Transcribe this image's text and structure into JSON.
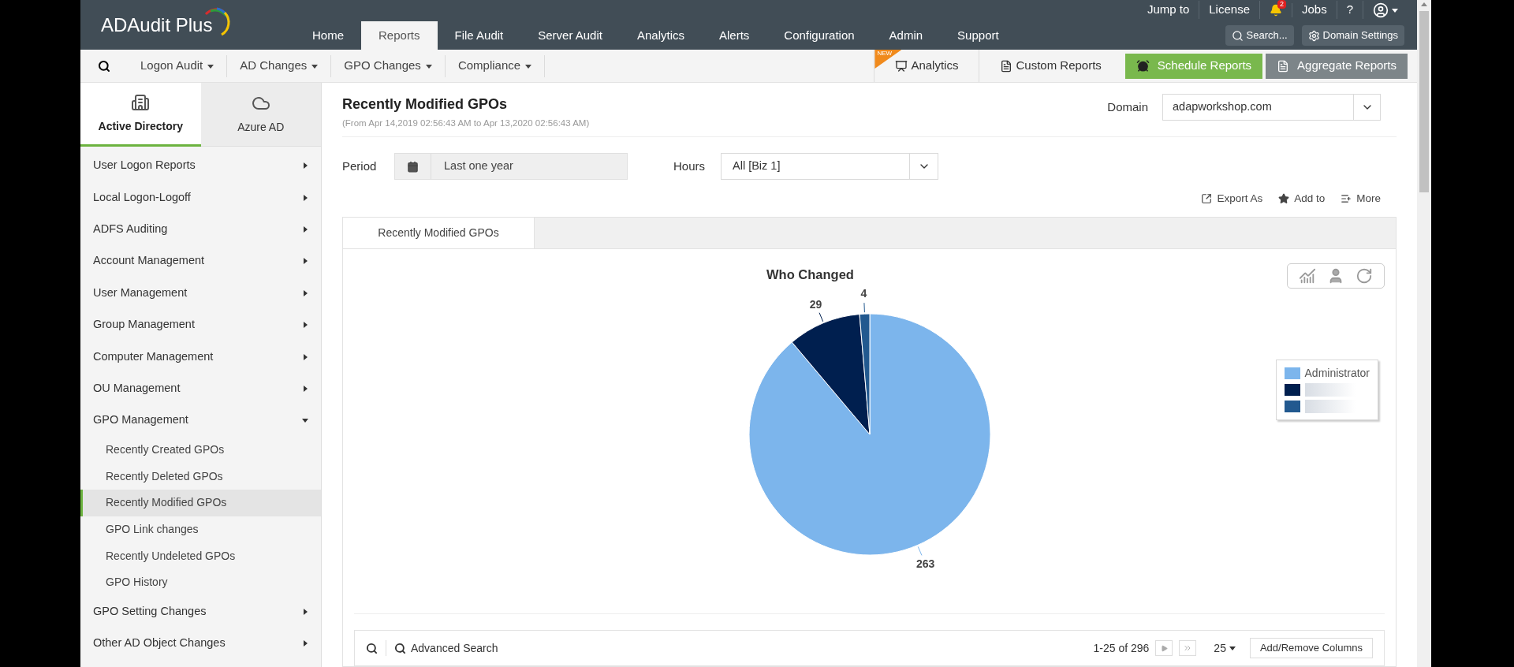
{
  "logo": "ADAudit Plus",
  "top_links": [
    {
      "kind": "text",
      "label": "Jump to"
    },
    {
      "kind": "text",
      "label": "License"
    },
    {
      "kind": "bell",
      "badge": "2"
    },
    {
      "kind": "text",
      "label": "Jobs"
    },
    {
      "kind": "text",
      "label": "?"
    },
    {
      "kind": "user"
    }
  ],
  "main_nav": [
    {
      "label": "Home",
      "selected": false
    },
    {
      "label": "Reports",
      "selected": true
    },
    {
      "label": "File Audit",
      "selected": false
    },
    {
      "label": "Server Audit",
      "selected": false
    },
    {
      "label": "Analytics",
      "selected": false
    },
    {
      "label": "Alerts",
      "selected": false
    },
    {
      "label": "Configuration",
      "selected": false
    },
    {
      "label": "Admin",
      "selected": false
    },
    {
      "label": "Support",
      "selected": false
    }
  ],
  "header_buttons": [
    {
      "kind": "search",
      "label": "Search..."
    },
    {
      "kind": "settings",
      "label": "Domain Settings"
    }
  ],
  "sub_nav": {
    "menus": [
      "Logon Audit",
      "AD Changes",
      "GPO Changes",
      "Compliance"
    ],
    "links": [
      {
        "kind": "analytics",
        "label": "Analytics",
        "badge": "NEW"
      },
      {
        "kind": "custom",
        "label": "Custom Reports"
      }
    ],
    "buttons": [
      {
        "kind": "primary",
        "label": "Schedule Reports"
      },
      {
        "kind": "secondary",
        "label": "Aggregate Reports"
      }
    ]
  },
  "sidebar": {
    "tabs": [
      {
        "kind": "building",
        "label": "Active Directory",
        "selected": true
      },
      {
        "kind": "cloud",
        "label": "Azure AD",
        "selected": false
      }
    ],
    "items": [
      {
        "label": "User Logon Reports",
        "expanded": false
      },
      {
        "label": "Local Logon-Logoff",
        "expanded": false
      },
      {
        "label": "ADFS Auditing",
        "expanded": false
      },
      {
        "label": "Account Management",
        "expanded": false
      },
      {
        "label": "User Management",
        "expanded": false
      },
      {
        "label": "Group Management",
        "expanded": false
      },
      {
        "label": "Computer Management",
        "expanded": false
      },
      {
        "label": "OU Management",
        "expanded": false
      },
      {
        "label": "GPO Management",
        "expanded": true,
        "children": [
          {
            "label": "Recently Created GPOs",
            "selected": false
          },
          {
            "label": "Recently Deleted GPOs",
            "selected": false
          },
          {
            "label": "Recently Modified GPOs",
            "selected": true
          },
          {
            "label": "GPO Link changes",
            "selected": false
          },
          {
            "label": "Recently Undeleted GPOs",
            "selected": false
          },
          {
            "label": "GPO History",
            "selected": false
          }
        ]
      },
      {
        "label": "GPO Setting Changes",
        "expanded": false
      },
      {
        "label": "Other AD Object Changes",
        "expanded": false
      }
    ]
  },
  "report": {
    "title": "Recently Modified GPOs",
    "range": "(From Apr 14,2019 02:56:43 AM to Apr 13,2020 02:56:43 AM)",
    "domain_label": "Domain",
    "domain": "adapworkshop.com",
    "period_label": "Period",
    "period": "Last one year",
    "hours_label": "Hours",
    "hours": "All [Biz 1]",
    "actions": [
      {
        "kind": "export",
        "label": "Export As"
      },
      {
        "kind": "star",
        "label": "Add to"
      },
      {
        "kind": "more",
        "label": "More"
      }
    ],
    "tabs": [
      {
        "label": "Recently Modified GPOs",
        "selected": true
      }
    ],
    "chart_data": {
      "type": "pie",
      "title": "Who Changed",
      "categories": [
        "Administrator",
        null,
        null
      ],
      "values": [
        263,
        29,
        4
      ],
      "colors": [
        "#7cb5ec",
        "#001f4f",
        "#22598f"
      ],
      "data_labels": true
    },
    "table_toolbar": {
      "advanced_search": "Advanced Search",
      "pagination": "1-25 of 296",
      "page_size": "25",
      "columns_button": "Add/Remove Columns"
    }
  }
}
